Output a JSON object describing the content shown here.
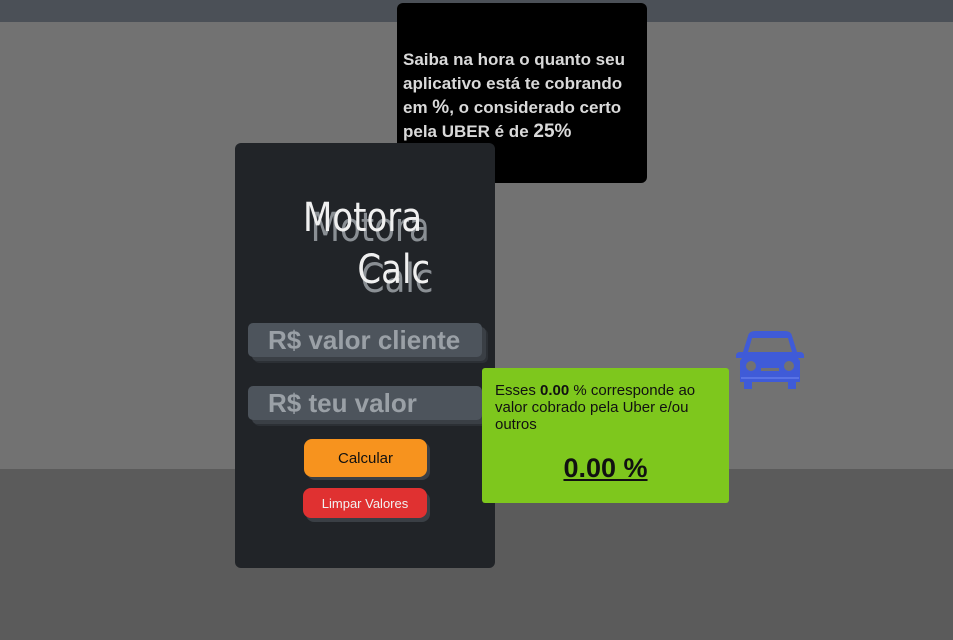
{
  "info": {
    "line1": "Saiba na hora o quanto seu aplicativo está te cobrando em ",
    "pct_sign": "%",
    "line2": ", o considerado certo pela UBER é de ",
    "uber_rate": "25%"
  },
  "logo": {
    "line1": "Motora",
    "line2": "Calc"
  },
  "form": {
    "client_placeholder": "R$ valor cliente",
    "mine_placeholder": "R$ teu valor",
    "calc_label": "Calcular",
    "clear_label": "Limpar Valores"
  },
  "result": {
    "prefix": "Esses ",
    "pct_value": "0.00",
    "suffix": " % corresponde ao valor cobrado pela Uber e/ou outros",
    "display": "0.00 %"
  },
  "colors": {
    "background": "#727272",
    "panel": "#212428",
    "info_box": "#000000",
    "calc_button": "#f7931e",
    "clear_button": "#e03131",
    "result_box": "#7ec71d",
    "car_icon": "#3f5bd8"
  },
  "icons": {
    "car": "car-icon"
  }
}
